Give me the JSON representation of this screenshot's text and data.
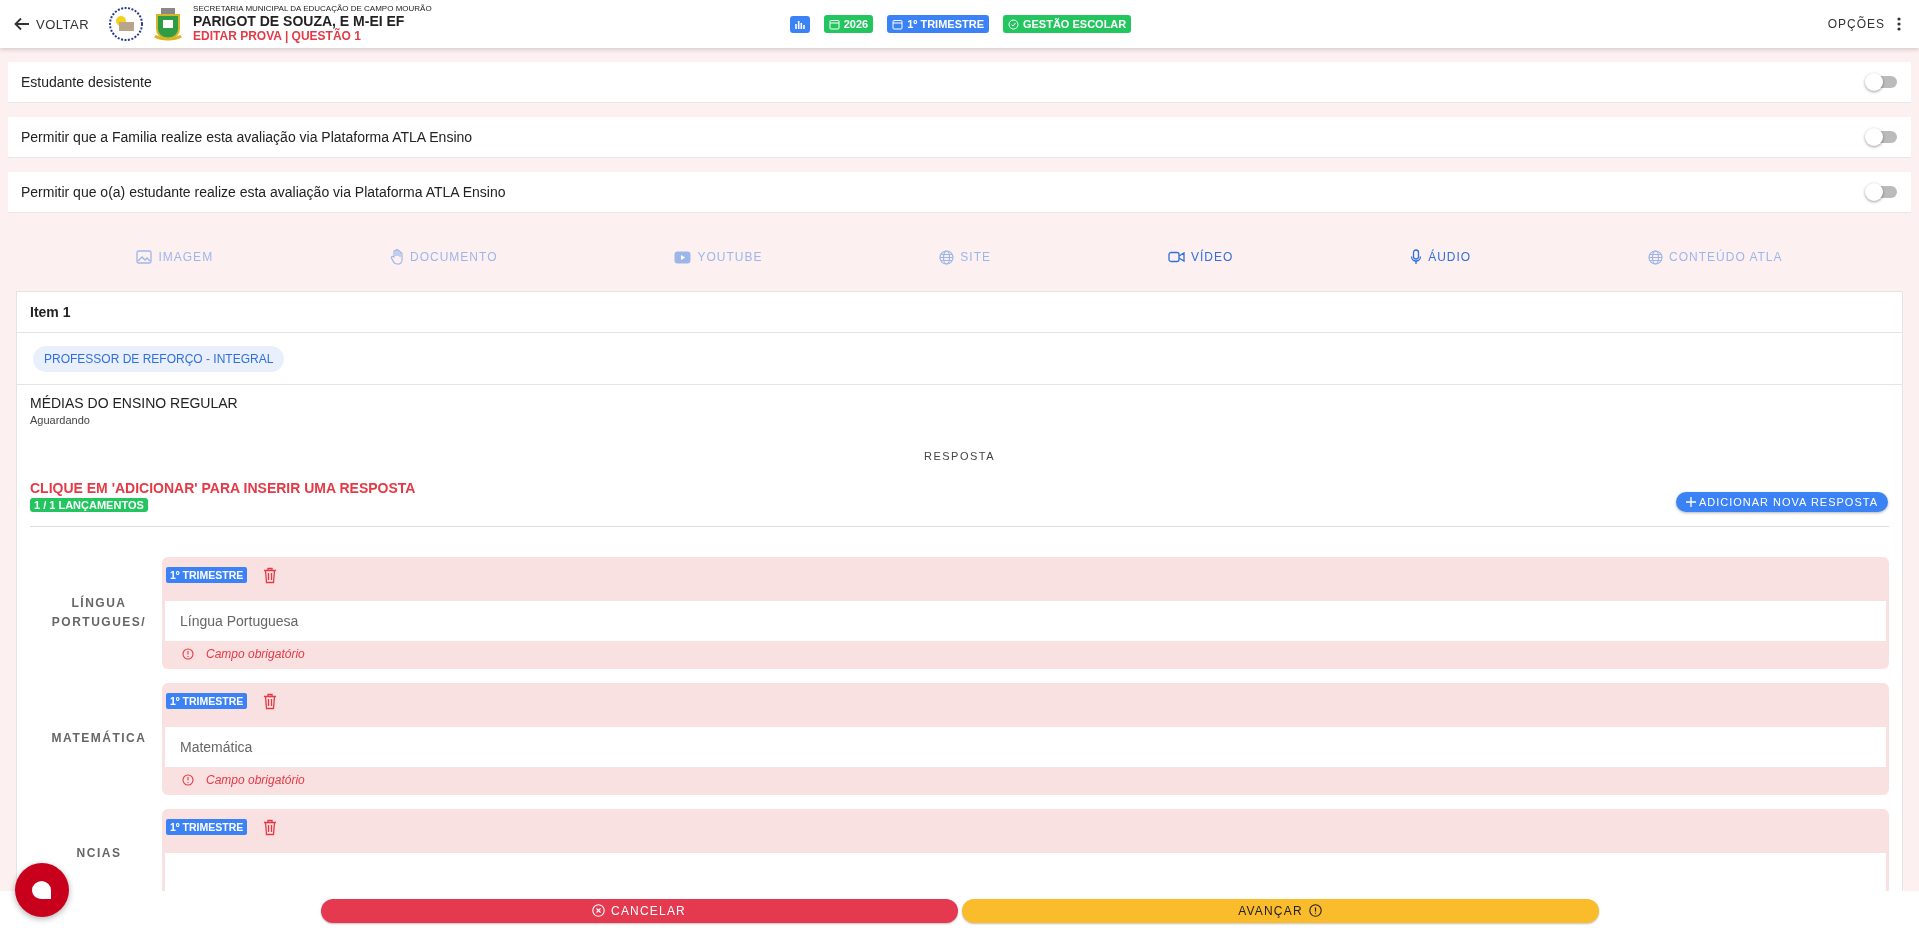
{
  "header": {
    "back": "VOLTAR",
    "org": "SECRETARIA MUNICIPAL DA EDUCAÇÃO DE CAMPO MOURÃO",
    "school": "PARIGOT DE SOUZA, E M-EI EF",
    "subtitle": "EDITAR PROVA | QUESTÃO 1",
    "chips": [
      {
        "kind": "chart",
        "color": "#3b82f6"
      },
      {
        "kind": "calendar",
        "label": "2026",
        "color": "#22c55e"
      },
      {
        "kind": "calendar",
        "label": "1º TRIMESTRE",
        "color": "#3b82f6"
      },
      {
        "kind": "check",
        "label": "GESTÃO ESCOLAR",
        "color": "#22c55e"
      }
    ],
    "options": "OPÇÕES"
  },
  "toggles": [
    {
      "label": "Estudante desistente",
      "on": false
    },
    {
      "label": "Permitir que a Familia realize esta avaliação via Plataforma ATLA Ensino",
      "on": false
    },
    {
      "label": "Permitir que o(a) estudante realize esta avaliação via Plataforma ATLA Ensino",
      "on": false
    }
  ],
  "media_tabs": [
    {
      "kind": "image",
      "label": "IMAGEM",
      "disabled": true
    },
    {
      "kind": "hand",
      "label": "DOCUMENTO",
      "disabled": true
    },
    {
      "kind": "youtube",
      "label": "YOUTUBE",
      "disabled": true
    },
    {
      "kind": "globe",
      "label": "SITE",
      "disabled": true
    },
    {
      "kind": "video",
      "label": "VÍDEO",
      "disabled": false
    },
    {
      "kind": "mic",
      "label": "ÁUDIO",
      "disabled": false
    },
    {
      "kind": "globe",
      "label": "CONTEÚDO ATLA",
      "disabled": true
    }
  ],
  "item": {
    "title": "Item 1",
    "role_chip": "PROFESSOR DE REFORÇO - INTEGRAL",
    "section_title": "MÉDIAS DO ENSINO REGULAR",
    "section_status": "Aguardando",
    "response_heading": "RESPOSTA",
    "instruction": "CLIQUE EM 'ADICIONAR' PARA INSERIR UMA RESPOSTA",
    "count_badge": "1 / 1 LANÇAMENTOS",
    "add_button": "ADICIONAR NOVA RESPOSTA",
    "answers": [
      {
        "label": "LÍNGUA PORTUGUES/",
        "badge": "1º TRIMESTRE",
        "placeholder": "Língua Portuguesa",
        "error": "Campo obrigatório"
      },
      {
        "label": "MATEMÁTICA",
        "badge": "1º TRIMESTRE",
        "placeholder": "Matemática",
        "error": "Campo obrigatório"
      },
      {
        "label": "NCIAS",
        "badge": "1º TRIMESTRE"
      }
    ]
  },
  "footer": {
    "cancel": "CANCELAR",
    "advance": "AVANÇAR"
  }
}
